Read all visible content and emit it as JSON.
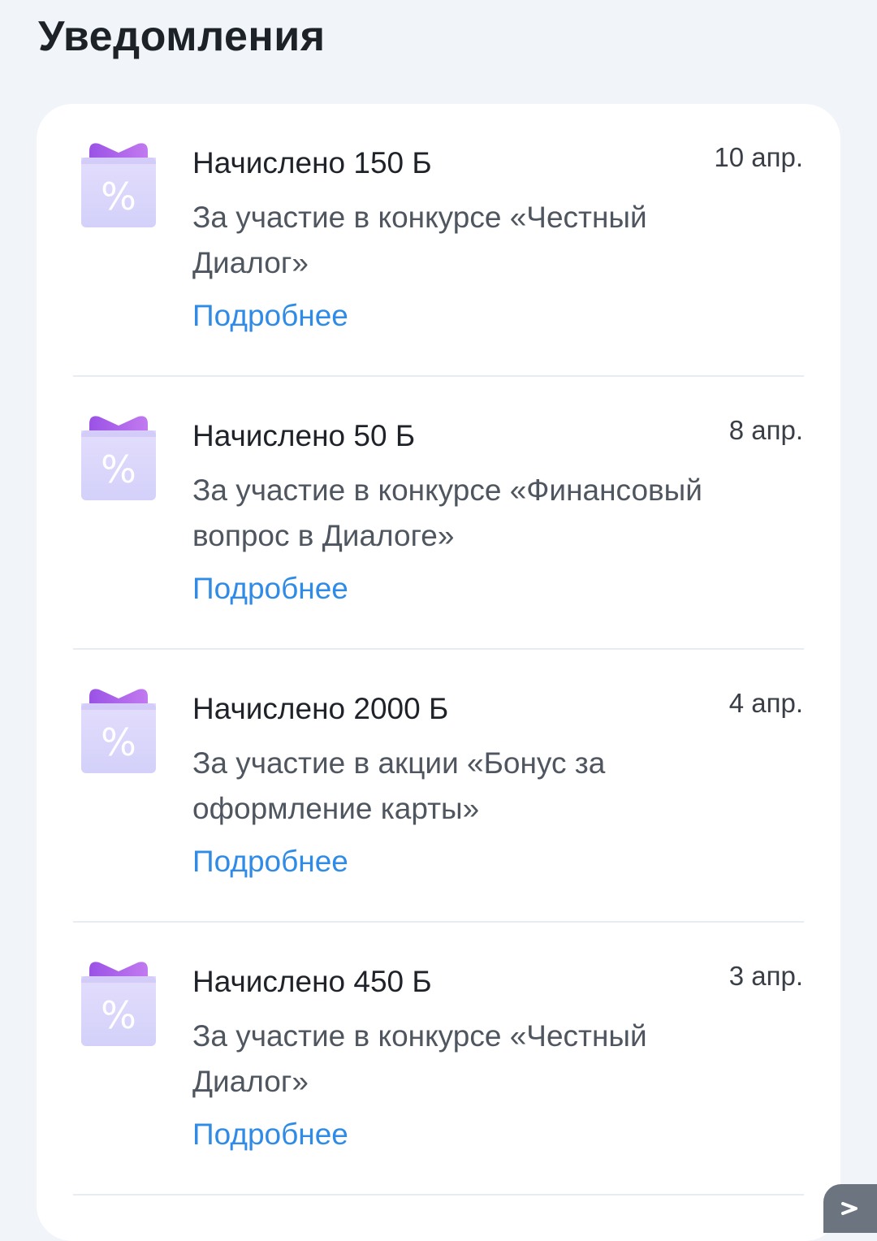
{
  "header": {
    "title": "Уведомления"
  },
  "notifications": [
    {
      "title": "Начислено 150 Б",
      "date": "10 апр.",
      "desc_line1": "За участие в конкурсе «Честный",
      "desc_line2": "Диалог»",
      "link": "Подробнее"
    },
    {
      "title": "Начислено 50 Б",
      "date": "8 апр.",
      "desc_line1": "За участие в конкурсе «Финансовый",
      "desc_line2": "вопрос в Диалоге»",
      "link": "Подробнее"
    },
    {
      "title": "Начислено 2000 Б",
      "date": "4 апр.",
      "desc_line1": "За участие в акции «Бонус за",
      "desc_line2": "оформление карты»",
      "link": "Подробнее"
    },
    {
      "title": "Начислено 450 Б",
      "date": "3 апр.",
      "desc_line1": "За участие в конкурсе «Честный",
      "desc_line2": "Диалог»",
      "link": "Подробнее"
    }
  ],
  "icons": {
    "notification": "gift-percent-icon",
    "scroll": "chevron-icon"
  },
  "colors": {
    "background": "#f1f4f8",
    "card": "#ffffff",
    "link": "#2f8be6",
    "icon_box": "#dcd9fb",
    "icon_bow": "#a45be8"
  }
}
